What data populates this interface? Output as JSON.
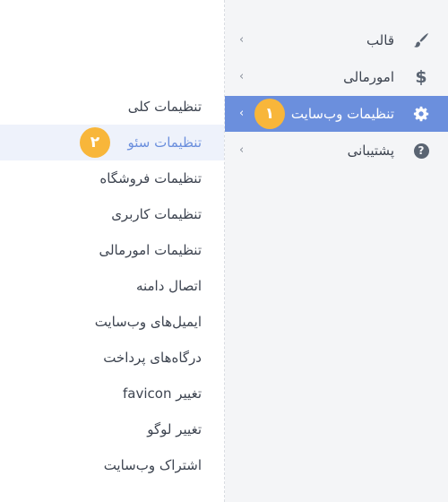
{
  "sidebar": {
    "items": [
      {
        "label": "قالب",
        "icon": "brush-icon"
      },
      {
        "label": "امورمالی",
        "icon": "dollar-icon"
      },
      {
        "label": "تنظیمات وب‌سایت",
        "icon": "gear-icon",
        "badge": "۱"
      },
      {
        "label": "پشتیبانی",
        "icon": "question-circle-icon"
      }
    ],
    "chevron": "›"
  },
  "submenu": {
    "items": [
      {
        "label": "تنظیمات کلی"
      },
      {
        "label": "تنظیمات سئو",
        "badge": "۲"
      },
      {
        "label": "تنظیمات فروشگاه"
      },
      {
        "label": "تنظیمات کاربری"
      },
      {
        "label": "تنظیمات امورمالی"
      },
      {
        "label": "اتصال دامنه"
      },
      {
        "label": "ایمیل‌های وب‌سایت"
      },
      {
        "label": "درگاه‌های پرداخت"
      },
      {
        "label": "تغییر favicon"
      },
      {
        "label": "تغییر لوگو"
      },
      {
        "label": "اشتراک وب‌سایت"
      }
    ]
  },
  "colors": {
    "accent": "#6b8fdd",
    "badge": "#f8b63a",
    "sidebar_bg": "#f4f5f7",
    "active_sub_bg": "#eef2fb"
  }
}
